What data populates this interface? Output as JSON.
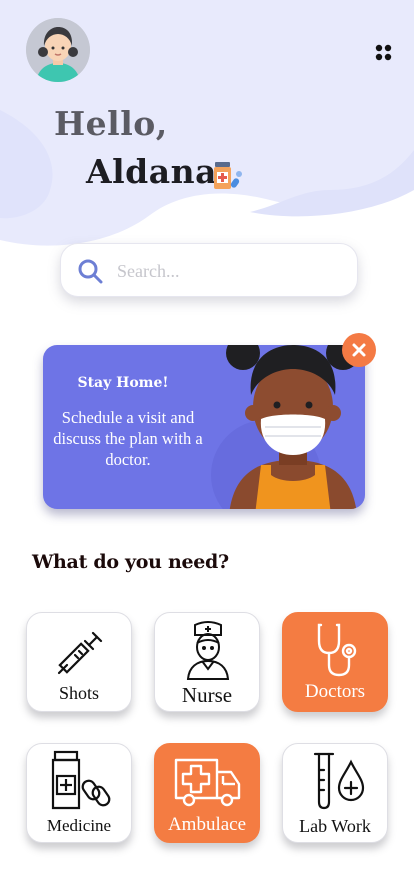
{
  "header": {
    "greeting": "Hello,",
    "user_name": "Aldana"
  },
  "search": {
    "placeholder": "Search..."
  },
  "banner": {
    "title": "Stay Home!",
    "message": "Schedule a visit and discuss the plan with a doctor."
  },
  "services": {
    "title": "What do you need?",
    "items": [
      {
        "label": "Shots",
        "icon": "syringe-icon",
        "highlighted": false
      },
      {
        "label": "Nurse",
        "icon": "nurse-icon",
        "highlighted": false
      },
      {
        "label": "Doctors",
        "icon": "stethoscope-icon",
        "highlighted": true
      },
      {
        "label": "Medicine",
        "icon": "medicine-icon",
        "highlighted": false
      },
      {
        "label": "Ambulace",
        "icon": "ambulance-icon",
        "highlighted": true
      },
      {
        "label": "Lab Work",
        "icon": "lab-work-icon",
        "highlighted": false
      }
    ]
  },
  "colors": {
    "accent": "#f47c42",
    "banner": "#6e74e6",
    "header_bg": "#e8eafc"
  }
}
